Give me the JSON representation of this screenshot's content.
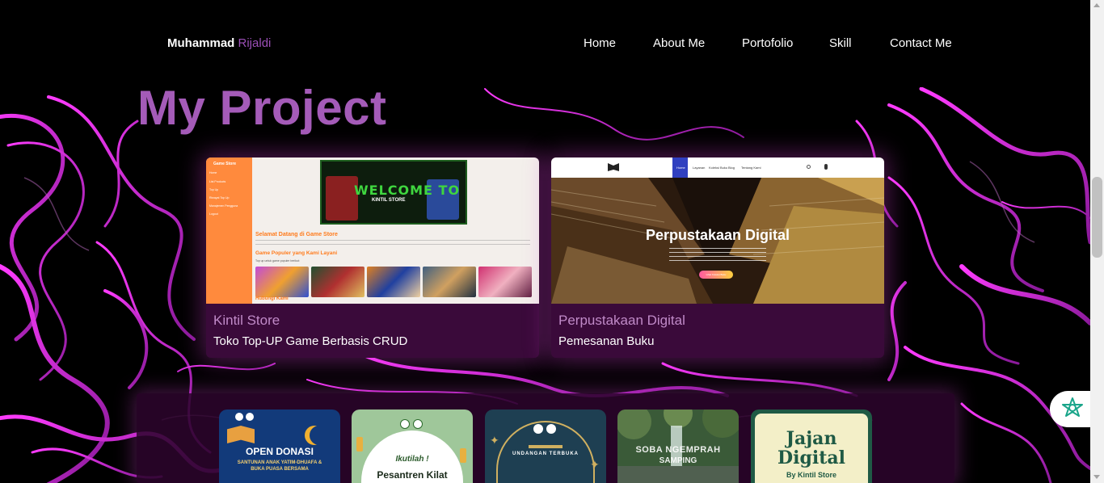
{
  "navbar": {
    "brand_first": "Muhammad",
    "brand_second": "Rijaldi",
    "links": [
      "Home",
      "About Me",
      "Portofolio",
      "Skill",
      "Contact Me"
    ]
  },
  "section_title": "My Project",
  "projects": [
    {
      "title": "Kintil Store",
      "description": "Toko Top-UP Game Berbasis CRUD",
      "thumb": {
        "sidebar_title": "Game Store",
        "sidebar_items": [
          "Home",
          "List Products",
          "Top Up",
          "Riwayat Top Up",
          "Manajemen Pengguna",
          "Logout"
        ],
        "banner_text": "WELCOME TO",
        "banner_sub": "KINTIL STORE",
        "heading": "Selamat Datang di Game Store",
        "subheading": "Game Populer yang Kami Layani",
        "subtext": "Top up untuk game populer berikut:",
        "footer": "Hubungi Kami"
      }
    },
    {
      "title": "Perpustakaan Digital",
      "description": "Pemesanan Buku",
      "thumb": {
        "nav_items": [
          "Home",
          "Layanan",
          "Koleksi Buku",
          "Blog",
          "Tentang Kami"
        ],
        "hero_title": "Perpustakaan Digital",
        "button_label": "Lihat Koleksi Buku"
      }
    }
  ],
  "posters": [
    {
      "title": "OPEN DONASI",
      "subtitle": "SANTUNAN ANAK YATIM-DHUAFA & BUKA PUASA BERSAMA"
    },
    {
      "title": "Ikutilah !",
      "subtitle": "Pesantren Kilat"
    },
    {
      "title": "UNDANGAN TERBUKA",
      "subtitle": ""
    },
    {
      "title": "SOBA NGEMPRAH",
      "subtitle": "SAMPING"
    },
    {
      "title": "Jajan Digital",
      "subtitle": "By Kintil Store"
    }
  ],
  "colors": {
    "accent": "#a45bb8",
    "card_bg": "#3a0a3a",
    "card_glow": "#d23cd2"
  }
}
